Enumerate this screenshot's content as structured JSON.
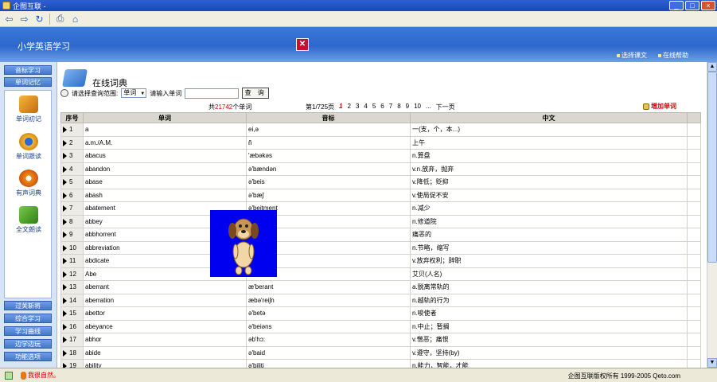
{
  "window": {
    "title": "企图互联 -"
  },
  "banner": {
    "title": "小学英语学习",
    "links": [
      "选择课文",
      "在线帮助"
    ]
  },
  "sidebar": {
    "top_tabs": [
      "音标学习",
      "单词记忆"
    ],
    "items": [
      {
        "label": "单词初记",
        "icon": "notebook-icon"
      },
      {
        "label": "单词跟读",
        "icon": "eye-icon"
      },
      {
        "label": "有声词典",
        "icon": "speaker-icon"
      },
      {
        "label": "全文朗读",
        "icon": "book-icon"
      }
    ],
    "bottom_tabs": [
      "过关斩将",
      "综合学习",
      "学习曲线",
      "边学边玩",
      "功能选项"
    ]
  },
  "main": {
    "heading": "在线词典",
    "search": {
      "scope_label": "请选择查询范围:",
      "scope_value": "单词",
      "input_label": "请输入单词",
      "button_label": "查 询"
    },
    "pager": {
      "total_prefix": "共",
      "total_count": "21742",
      "total_suffix": "个单词",
      "page_info": "第1/725页",
      "current_page": "1",
      "pages": [
        "2",
        "3",
        "4",
        "5",
        "6",
        "7",
        "8",
        "9",
        "10",
        "..."
      ],
      "next": "下一页",
      "add_word": "增加单词"
    },
    "columns": [
      "序号",
      "单词",
      "音标",
      "中文"
    ],
    "rows": [
      {
        "no": "1",
        "word": "a",
        "phonetic": "ei,ə",
        "meaning": "一(支，个，本...)"
      },
      {
        "no": "2",
        "word": "a.m./A.M.",
        "phonetic": "ñ",
        "meaning": "上午"
      },
      {
        "no": "3",
        "word": "abacus",
        "phonetic": "'æbəkəs",
        "meaning": "n.算盘"
      },
      {
        "no": "4",
        "word": "abandon",
        "phonetic": "ə'bændən",
        "meaning": "v.n.放弃，抛弃"
      },
      {
        "no": "5",
        "word": "abase",
        "phonetic": "ə'beis",
        "meaning": "v.降低；贬抑"
      },
      {
        "no": "6",
        "word": "abash",
        "phonetic": "ə'bæʃ",
        "meaning": "v.使局促不安"
      },
      {
        "no": "7",
        "word": "abatement",
        "phonetic": "ə'beitment",
        "meaning": "n.减少"
      },
      {
        "no": "8",
        "word": "abbey",
        "phonetic": "",
        "meaning": "n.修道院"
      },
      {
        "no": "9",
        "word": "abbhorrent",
        "phonetic": "",
        "meaning": "痛恶的"
      },
      {
        "no": "10",
        "word": "abbreviation",
        "phonetic": "on",
        "meaning": "n.节略，缩写"
      },
      {
        "no": "11",
        "word": "abdicate",
        "phonetic": "",
        "meaning": "v.放弃权利；辞职"
      },
      {
        "no": "12",
        "word": "Abe",
        "phonetic": "",
        "meaning": "艾贝(人名)"
      },
      {
        "no": "13",
        "word": "aberrant",
        "phonetic": "æ'berant",
        "meaning": "a.脱离常轨的"
      },
      {
        "no": "14",
        "word": "aberration",
        "phonetic": "æbə'reiʃn",
        "meaning": "n.越轨的行为"
      },
      {
        "no": "15",
        "word": "abettor",
        "phonetic": "ə'betə",
        "meaning": "n.唆使者"
      },
      {
        "no": "16",
        "word": "abeyance",
        "phonetic": "ə'beiəns",
        "meaning": "n.中止；暂搁"
      },
      {
        "no": "17",
        "word": "abhor",
        "phonetic": "əb'hɔ:",
        "meaning": "v.憎恶；痛恨"
      },
      {
        "no": "18",
        "word": "abide",
        "phonetic": "ə'baid",
        "meaning": "v.遵守，坚持(by)"
      },
      {
        "no": "19",
        "word": "ability",
        "phonetic": "ə'biliti",
        "meaning": "n.能力，智能，才能"
      }
    ]
  },
  "status": {
    "emotion": "我很自然。",
    "copyright": "企图互联版权所有  1999-2005 Qeto.com"
  },
  "colors": {
    "banner": "#2d68cc",
    "accent_red": "#d00000",
    "agent_bg": "#0000f0"
  }
}
